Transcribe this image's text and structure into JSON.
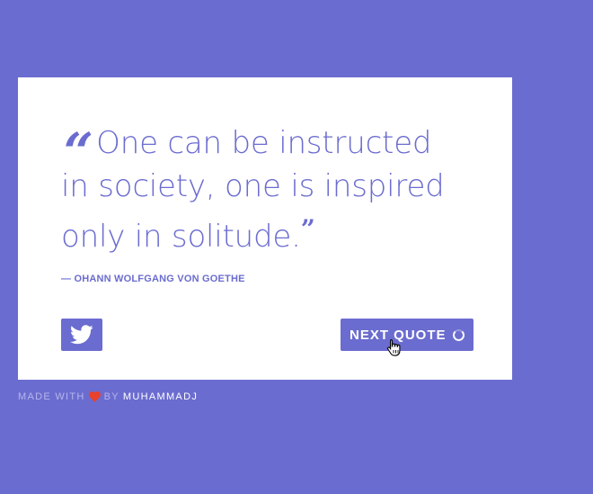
{
  "quote": {
    "text": "One can be instructed in society, one is inspired only in solitude.",
    "open_mark": "“",
    "close_mark": "”",
    "author": "— OHANN WOLFGANG VON GOETHE"
  },
  "actions": {
    "tweet_icon": "twitter-icon",
    "next_label": "NEXT QUOTE",
    "loading_icon": "spinner-icon"
  },
  "footer": {
    "made_with": "MADE WITH",
    "heart_icon": "heart-icon",
    "by": "BY",
    "author": "MUHAMMADJ"
  },
  "colors": {
    "background": "#6b6ccf",
    "card": "#ffffff",
    "accent": "#6b6ccf",
    "heart": "#e8412c"
  }
}
